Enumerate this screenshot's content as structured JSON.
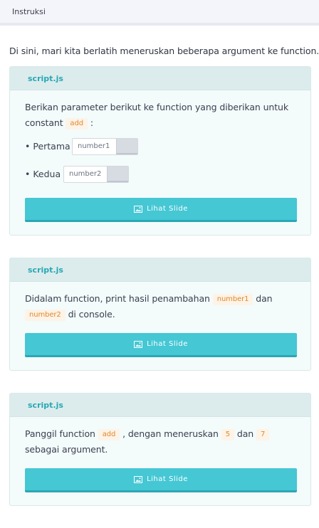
{
  "header": {
    "title": "Instruksi"
  },
  "intro": "Di sini, mari kita berlatih meneruskan beberapa argument ke function.",
  "cards": [
    {
      "file": "script.js",
      "text_before": "Berikan parameter berikut ke function yang diberikan untuk constant ",
      "code": "add",
      "text_after": " :",
      "params": [
        {
          "bullet": "• Pertama",
          "placeholder": "number1"
        },
        {
          "bullet": "• Kedua",
          "placeholder": "number2"
        }
      ],
      "button": "Lihat Slide"
    },
    {
      "file": "script.js",
      "text_a": "Didalam function, print hasil penambahan ",
      "code_a": "number1",
      "text_b": " dan",
      "code_b": "number2",
      "text_c": " di console.",
      "button": "Lihat Slide"
    },
    {
      "file": "script.js",
      "text_a": "Panggil function ",
      "code_a": "add",
      "text_b": " , dengan meneruskan ",
      "code_b": "5",
      "text_c": " dan ",
      "code_c": "7",
      "text_d": " sebagai argument.",
      "button": "Lihat Slide"
    }
  ],
  "icons": {
    "slide_button": "image-icon"
  },
  "colors": {
    "accent": "#45c7d4",
    "accent_dark": "#2aa7b4",
    "code_text": "#e08a2c",
    "code_bg": "#fdf3e7"
  }
}
